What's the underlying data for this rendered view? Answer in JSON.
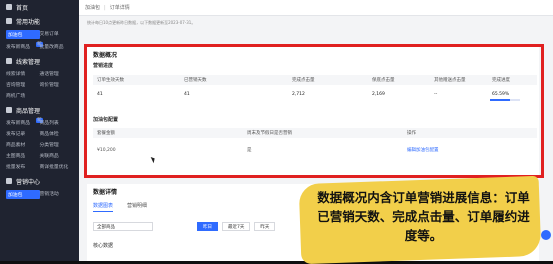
{
  "sidebar": {
    "home": "首页",
    "sections": [
      {
        "title": "常用功能",
        "items": [
          {
            "label": "加油包",
            "active": true
          },
          {
            "label": "交易订单"
          },
          {
            "label": "发布新商品",
            "tag": "新"
          },
          {
            "label": "批量改商品"
          }
        ]
      },
      {
        "title": "线索管理",
        "items": [
          {
            "label": "线索详情"
          },
          {
            "label": "通话管理"
          },
          {
            "label": "咨询管理"
          },
          {
            "label": "询价管理"
          },
          {
            "label": "商机广场"
          }
        ]
      },
      {
        "title": "商品管理",
        "items": [
          {
            "label": "发布新商品",
            "tag": "新"
          },
          {
            "label": "商品列表"
          },
          {
            "label": "发布记录"
          },
          {
            "label": "商品体检"
          },
          {
            "label": "商品素材"
          },
          {
            "label": "分类管理"
          },
          {
            "label": "主图商品"
          },
          {
            "label": "关联商品"
          },
          {
            "label": "批量发布"
          },
          {
            "label": "商详批量优化"
          }
        ]
      },
      {
        "title": "营销中心",
        "items": [
          {
            "label": "加油包",
            "active": true
          },
          {
            "label": "营销活动"
          }
        ]
      }
    ]
  },
  "breadcrumb": {
    "root": "加油包",
    "current": "订单详情"
  },
  "notice": "统计每日10点更新昨日数据，以下数据更新至2023-07-31。",
  "overview": {
    "title": "数据概况",
    "progress_title": "营销进度",
    "columns": [
      "订单生效天数",
      "已营销天数",
      "完成点击量",
      "保底点击量",
      "其他赠送点击量",
      "完成进度"
    ],
    "values": [
      "41",
      "41",
      "2,712",
      "2,169",
      "--",
      "65.59%"
    ],
    "progress_fraction": 0.6559,
    "package_title": "加油包配置",
    "package_columns": [
      "套餐金额",
      "周末及节假日是否营销",
      "操作"
    ],
    "package_values": [
      "¥10,200",
      "是",
      "编辑加油包配置"
    ]
  },
  "detail": {
    "title": "数据详情",
    "tabs": [
      "数据图表",
      "营销明细"
    ],
    "select_value": "全部商品",
    "buttons": [
      "昨日",
      "最近7天",
      "昨天"
    ],
    "core_title": "核心数据"
  },
  "caption": "数据概况内含订单营销进展信息：订单已营销天数、完成点击量、订单履约进度等。",
  "colors": {
    "accent": "#2f6bff",
    "highlight": "#e02020",
    "banner": "#f2cf4a"
  }
}
